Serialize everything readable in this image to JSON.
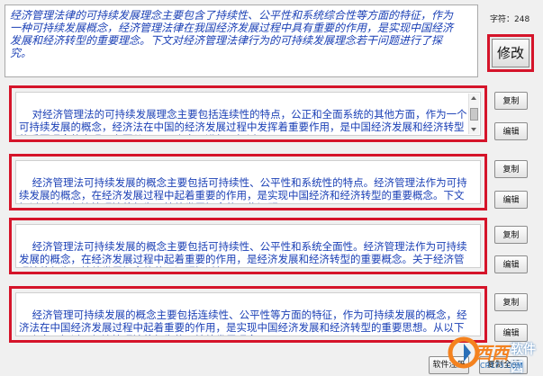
{
  "source_text": "经济管理法律的可持续发展理念主要包含了持续性、公平性和系统综合性等方面的特征，作为一种可持续发展概念，经济管理法律在我国经济发展过程中具有重要的作用，是实现中国经济发展和经济转型的重要理念。下文对经济管理法律行为的可持续发展理念若干问题进行了探究。",
  "char_count_label": "字符：248",
  "modify_label": "修改",
  "results": [
    {
      "text": "对经济管理法的可持续发展理念主要包括连续性的特点，公正和全面系统的其他方面，作为一个可持续发展的概念，经济法在中国的经济发展过程中发挥着重要作用，是中国经济发展和经济转型的重要理念的实现。主要从以下几个方面进行了探讨",
      "copy_label": "复制",
      "edit_label": "编辑"
    },
    {
      "text": "经济管理法可持续发展的概念主要包括可持续性、公平性和系统性的特点。经济管理法作为可持续发展的概念，在经济发展过程中起着重要的作用，是实现中国经济和经济转型的重要概念。下文探讨了关于经济管理法律行为可持续发展概念的一些问题。",
      "copy_label": "复制",
      "edit_label": "编辑"
    },
    {
      "text": "经济管理法可持续发展的概念主要包括可持续性、公平性和系统全面性。经济管理法作为可持续发展的概念，在经济发展过程中起着重要的作用，是经济发展和经济转型的重要概念。关于经济管理法律行为可持续发展概念的若干问题探讨如下。",
      "copy_label": "复制",
      "edit_label": "编辑"
    },
    {
      "text": "经济管理可持续发展的概念主要包括连续性、公平性等方面的特征，作为可持续发展的概念，经济法在中国经济发展过程中起着重要的作用，是实现中国经济发展和经济转型的重要思想。从以下几个方面探讨了经济管理法律行为的可持续发展理念。",
      "copy_label": "复制",
      "edit_label": "编辑"
    }
  ],
  "bottom_buttons": [
    "软件注册",
    "复制全部"
  ],
  "watermark": {
    "brand": "西西",
    "suffix": "软件园",
    "url": "CR173.COM"
  },
  "colors": {
    "frame": "#d5142a",
    "text": "#1a3fb5",
    "watermark_orange": "#f4821f"
  }
}
